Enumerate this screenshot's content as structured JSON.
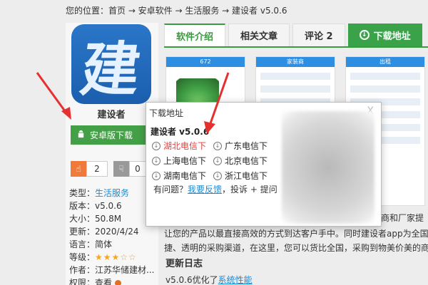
{
  "breadcrumb": "您的位置：首页 → 安卓软件 → 生活服务 → 建设者 v5.0.6",
  "app": {
    "icon_glyph": "建",
    "name": "建设者"
  },
  "download_button": "安卓版下载",
  "votes": {
    "up": "2",
    "down": "0"
  },
  "info": {
    "type_label": "类型：",
    "type_value": "生活服务",
    "version": "版本：v5.0.6",
    "size": "大小：50.8M",
    "updated": "更新：2020/4/24",
    "language": "语言：简体",
    "rating_label": "等级：",
    "rating_stars": "★★★☆☆",
    "author": "作者：江苏华储建材...",
    "permission": "权限：查看"
  },
  "tabs": [
    {
      "label": "软件介绍"
    },
    {
      "label": "相关文章"
    },
    {
      "label": "评论 2"
    },
    {
      "label": "下载地址"
    }
  ],
  "screens": [
    {
      "bar": "672"
    },
    {
      "bar": "家装商"
    },
    {
      "bar": "出租"
    }
  ],
  "description": {
    "line1": "销商和厂家提",
    "line2": "让您的产品以最直接高效的方式到达客户手中。同时建设者app为全国",
    "line3": "捷、透明的采购渠道，在这里，您可以货比全国，采购到物美价美的商"
  },
  "changelog_title": "更新日志",
  "changelog_line": {
    "prefix": "v5.0.6优化了",
    "link": "系统性能"
  },
  "modal": {
    "title": "下载地址",
    "close": "X",
    "heading": "建设者 v5.0.6",
    "links": [
      "湖北电信下",
      "广东电信下",
      "上海电信下",
      "北京电信下",
      "湖南电信下",
      "浙江电信下"
    ],
    "question_prefix": "有问题？",
    "feedback": "我要反馈",
    "question_suffix": "，投诉 + 提问"
  },
  "colors": {
    "green": "#3a9a3e",
    "blue": "#1d8bd1",
    "red": "#e23b3b",
    "orange": "#f07a3a"
  }
}
